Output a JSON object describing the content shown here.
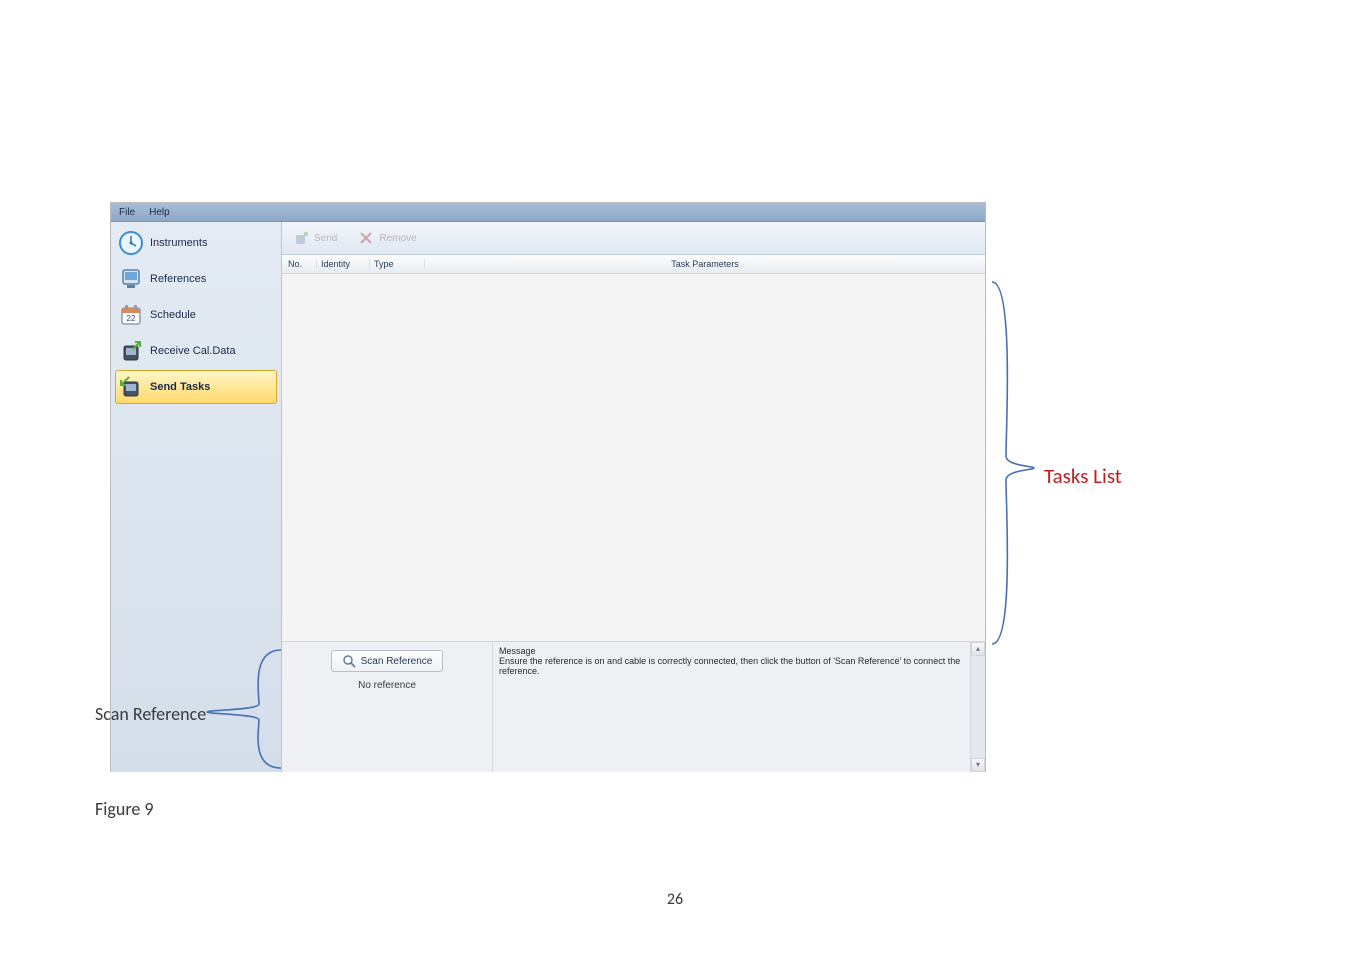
{
  "menu": {
    "file": "File",
    "help": "Help"
  },
  "sidebar": {
    "items": [
      {
        "label": "Instruments"
      },
      {
        "label": "References"
      },
      {
        "label": "Schedule"
      },
      {
        "label": "Receive Cal.Data"
      },
      {
        "label": "Send Tasks"
      }
    ]
  },
  "toolbar": {
    "send": "Send",
    "remove": "Remove"
  },
  "grid": {
    "no": "No.",
    "identity": "Identity",
    "type": "Type",
    "params": "Task Parameters"
  },
  "scan": {
    "button": "Scan Reference",
    "status": "No reference"
  },
  "message": {
    "title": "Message",
    "text": "Ensure the reference is on and cable is correctly connected, then click the button of 'Scan Reference' to connect the reference."
  },
  "annotations": {
    "tasks_list": "Tasks List",
    "scan_reference": "Scan Reference",
    "figure": "Figure 9"
  },
  "page_number": "26",
  "icons": {
    "schedule_day": "22"
  }
}
